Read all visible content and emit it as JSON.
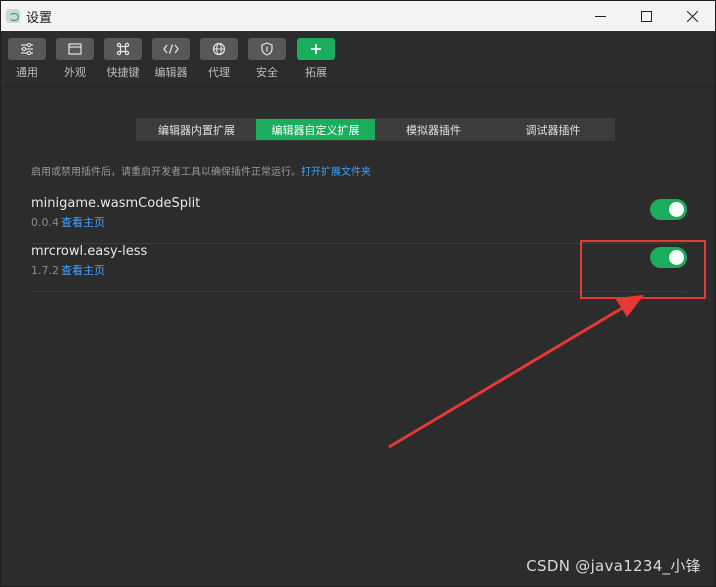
{
  "window": {
    "title": "设置",
    "controls": [
      "minimize",
      "maximize",
      "close"
    ]
  },
  "toolbar": {
    "items": [
      {
        "label": "通用",
        "icon": "sliders-icon"
      },
      {
        "label": "外观",
        "icon": "window-layout-icon"
      },
      {
        "label": "快捷键",
        "icon": "command-key-icon"
      },
      {
        "label": "编辑器",
        "icon": "code-brackets-icon"
      },
      {
        "label": "代理",
        "icon": "globe-icon"
      },
      {
        "label": "安全",
        "icon": "shield-icon"
      },
      {
        "label": "拓展",
        "icon": "plus-icon",
        "active": true
      }
    ]
  },
  "tabs": [
    {
      "label": "编辑器内置扩展",
      "selected": false
    },
    {
      "label": "编辑器自定义扩展",
      "selected": true
    },
    {
      "label": "模拟器插件",
      "selected": false
    },
    {
      "label": "调试器插件",
      "selected": false
    }
  ],
  "notice": {
    "text": "启用或禁用插件后，请重启开发者工具以确保插件正常运行。",
    "link": "打开扩展文件夹"
  },
  "plugins": [
    {
      "name": "minigame.wasmCodeSplit",
      "version": "0.0.4",
      "homepage_label": "查看主页",
      "enabled": true
    },
    {
      "name": "mrcrowl.easy-less",
      "version": "1.7.2",
      "homepage_label": "查看主页",
      "enabled": true
    }
  ],
  "watermark": "CSDN @java1234_小锋",
  "colors": {
    "accent": "#1aad5e",
    "link": "#3ea3ff",
    "annotation": "#e53935",
    "background": "#2c2c2c"
  }
}
